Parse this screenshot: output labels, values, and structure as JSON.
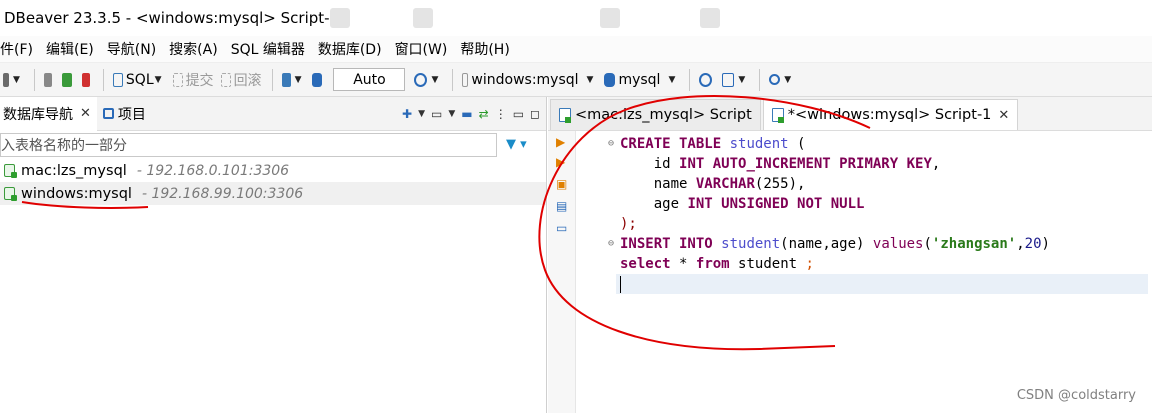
{
  "window": {
    "title": "DBeaver 23.3.5 - <windows:mysql> Script-1"
  },
  "menu": [
    "件(F)",
    "编辑(E)",
    "导航(N)",
    "搜索(A)",
    "SQL 编辑器",
    "数据库(D)",
    "窗口(W)",
    "帮助(H)"
  ],
  "toolbar": {
    "sql_label": "SQL",
    "commit_label": "提交",
    "rollback_label": "回滚",
    "transaction_mode": "Auto",
    "connection": "windows:mysql",
    "schema": "mysql"
  },
  "navigator": {
    "tabs": [
      {
        "label": "数据库导航"
      },
      {
        "label": "项目"
      }
    ],
    "filter_text": "入表格名称的一部分",
    "connections": [
      {
        "name": "mac:lzs_mysql",
        "host": "- 192.168.0.101:3306"
      },
      {
        "name": "windows:mysql",
        "host": "- 192.168.99.100:3306"
      }
    ]
  },
  "editor": {
    "tabs": [
      {
        "label": "<mac:lzs_mysql> Script"
      },
      {
        "label": "*<windows:mysql> Script-1"
      }
    ],
    "code": {
      "l1": {
        "kw": "CREATE TABLE",
        "tbl": "student",
        "rest": "("
      },
      "l2": {
        "col": "id",
        "kw": "INT AUTO_INCREMENT PRIMARY KEY",
        "rest": ","
      },
      "l3": {
        "col": "name",
        "kw": "VARCHAR",
        "rest": "(255),"
      },
      "l4": {
        "col": "age",
        "kw": "INT UNSIGNED NOT NULL"
      },
      "l5": {
        "rest": ");"
      },
      "l6": {
        "kw": "INSERT INTO",
        "tbl": "student",
        "cols": "(name,age)",
        "kw2": "values",
        "str": "'zhangsan'",
        "num": "20",
        "rest": ")"
      },
      "l7": {
        "kw": "select",
        "mid": "*",
        "kw2": "from",
        "tbl": "student",
        "rest": ";"
      }
    }
  },
  "watermark": "CSDN @coldstarry",
  "colors": {
    "keyword": "#7f0055",
    "table": "#4d4dcc",
    "string": "#2a7a1a",
    "annotation": "#e00000"
  }
}
